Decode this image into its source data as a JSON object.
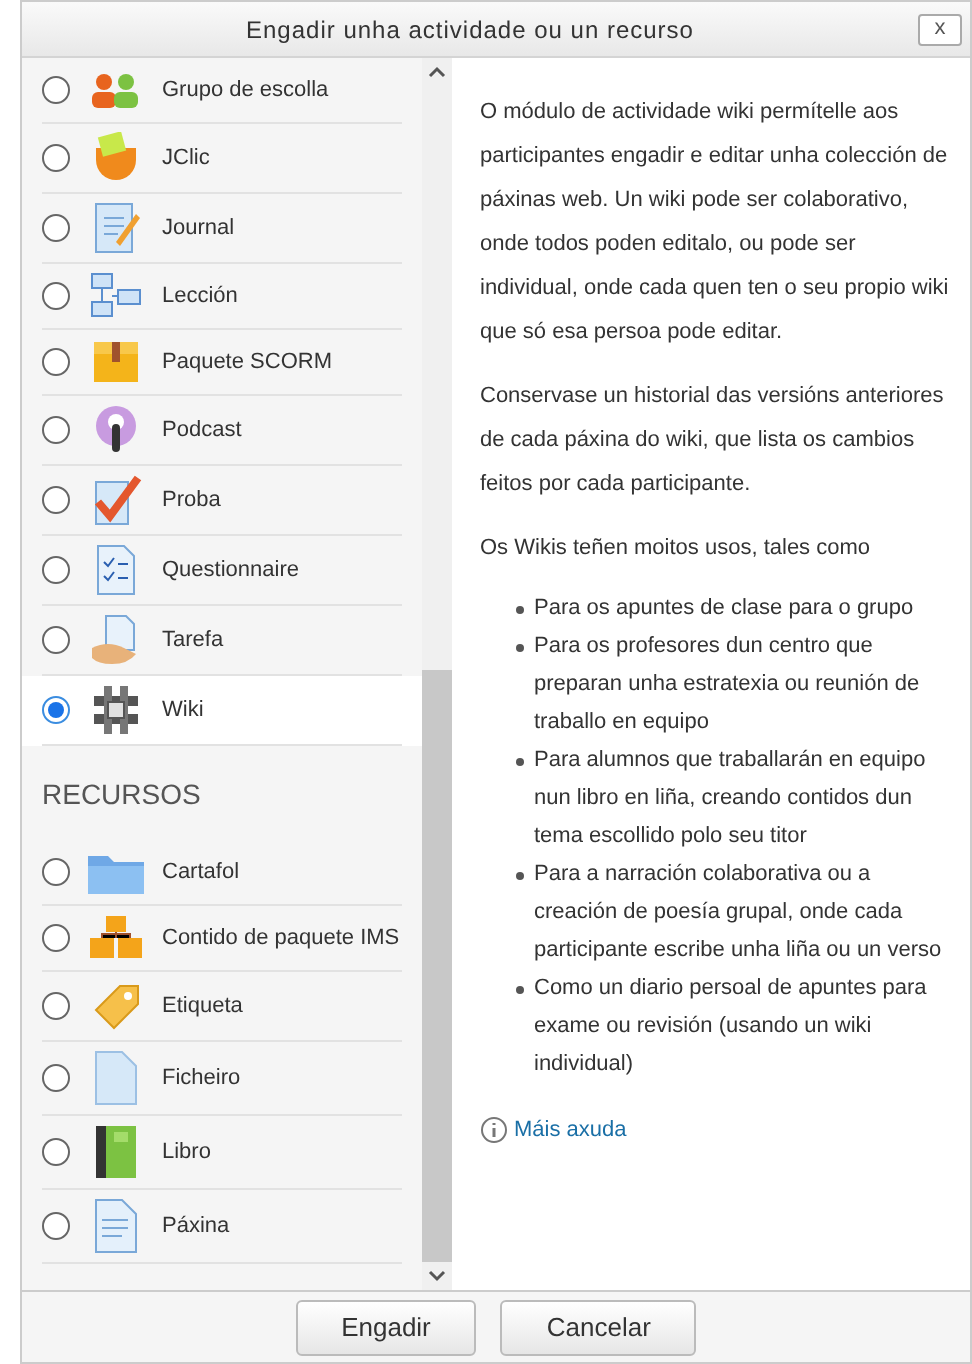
{
  "dialog": {
    "title": "Engadir unha actividade ou un recurso",
    "close_label": "x"
  },
  "activities": [
    {
      "label": "Grupo de escolla",
      "selected": false
    },
    {
      "label": "JClic",
      "selected": false
    },
    {
      "label": "Journal",
      "selected": false
    },
    {
      "label": "Lección",
      "selected": false
    },
    {
      "label": "Paquete SCORM",
      "selected": false
    },
    {
      "label": "Podcast",
      "selected": false
    },
    {
      "label": "Proba",
      "selected": false
    },
    {
      "label": "Questionnaire",
      "selected": false
    },
    {
      "label": "Tarefa",
      "selected": false
    },
    {
      "label": "Wiki",
      "selected": true
    }
  ],
  "resources": {
    "heading": "RECURSOS",
    "items": [
      {
        "label": "Cartafol",
        "selected": false
      },
      {
        "label": "Contido de paquete IMS",
        "selected": false
      },
      {
        "label": "Etiqueta",
        "selected": false
      },
      {
        "label": "Ficheiro",
        "selected": false
      },
      {
        "label": "Libro",
        "selected": false
      },
      {
        "label": "Páxina",
        "selected": false
      }
    ]
  },
  "description": {
    "paragraphs": [
      "O módulo de actividade wiki permítelle aos participantes engadir e editar unha colección de páxinas web. Un wiki pode ser colaborativo, onde todos poden editalo, ou pode ser individual, onde cada quen ten o seu propio wiki que só esa persoa pode editar.",
      "Conservase un historial das versións anteriores de cada páxina do wiki, que lista os cambios feitos por cada participante.",
      "Os Wikis teñen moitos usos, tales como"
    ],
    "bullets": [
      "Para os apuntes de clase para o grupo",
      "Para os profesores dun centro que preparan unha estratexia ou reunión de traballo en equipo",
      "Para alumnos que traballarán en equipo nun libro en liña, creando contidos dun tema escollido polo seu titor",
      "Para a narración colaborativa ou a creación de poesía grupal, onde cada participante escribe unha liña ou un verso",
      "Como un diario persoal de apuntes para exame ou revisión (usando un wiki individual)"
    ],
    "help_link": "Máis axuda"
  },
  "buttons": [
    "Engadir",
    "Cancelar"
  ]
}
